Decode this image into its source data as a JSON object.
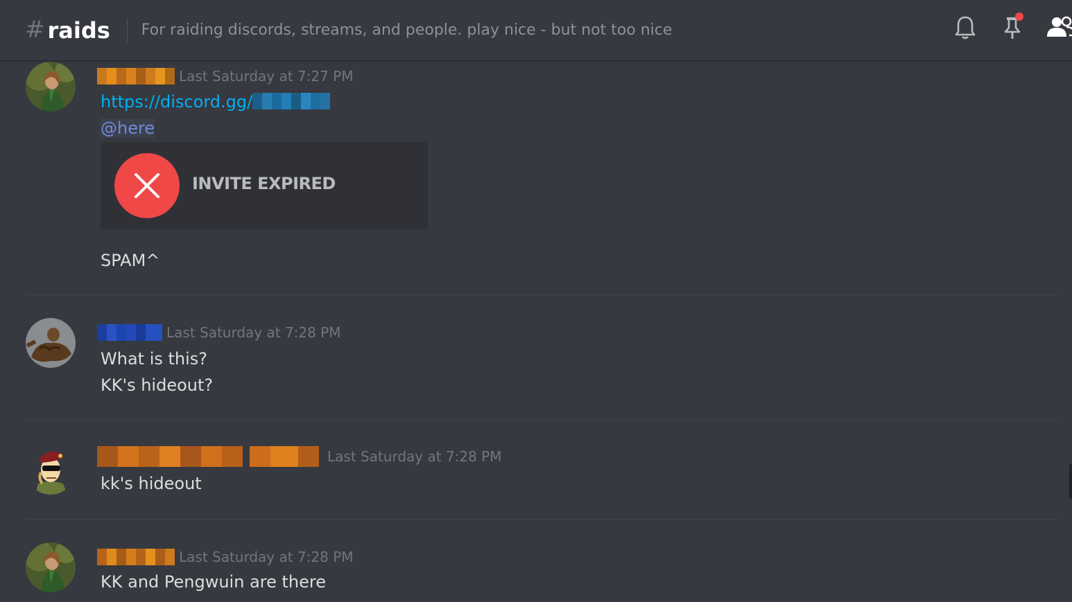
{
  "channel": {
    "hash": "#",
    "name": "raids",
    "topic": "For raiding discords, streams, and people. play nice - but not too nice"
  },
  "header_icons": [
    "bell-icon",
    "pin-icon",
    "members-icon"
  ],
  "colors": {
    "background": "#36393f",
    "link": "#00b0f4",
    "mention": "#7289da",
    "error_red": "#f04747"
  },
  "messages": [
    {
      "timestamp": "Last Saturday at 7:27 PM",
      "link": "https://discord.gg/",
      "mention": "@here",
      "invite_label": "INVITE EXPIRED",
      "text": "SPAM^"
    },
    {
      "timestamp": "Last Saturday at 7:28 PM",
      "line1": "What is this?",
      "line2": "KK's hideout?"
    },
    {
      "timestamp": "Last Saturday at 7:28 PM",
      "text": "kk's hideout"
    },
    {
      "timestamp": "Last Saturday at 7:28 PM",
      "text": "KK and Pengwuin are there"
    }
  ]
}
